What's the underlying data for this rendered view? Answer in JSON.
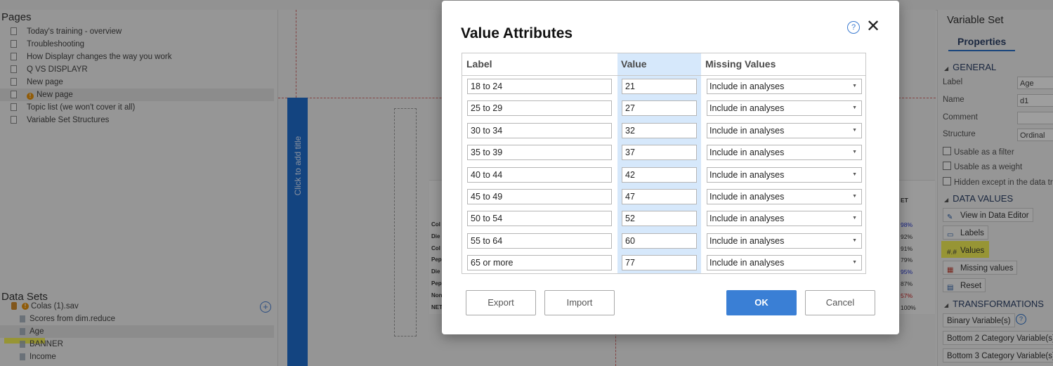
{
  "left_pane": {
    "pages_heading": "Pages",
    "pages": [
      {
        "label": "Today's training - overview",
        "warning": false,
        "selected": false
      },
      {
        "label": "Troubleshooting",
        "warning": false,
        "selected": false
      },
      {
        "label": "How Displayr changes the way you work",
        "warning": false,
        "selected": false
      },
      {
        "label": "Q VS DISPLAYR",
        "warning": false,
        "selected": false
      },
      {
        "label": "New page",
        "warning": false,
        "selected": false
      },
      {
        "label": "New page",
        "warning": true,
        "selected": true
      },
      {
        "label": "Topic list (we won't cover it all)",
        "warning": false,
        "selected": false
      },
      {
        "label": "Variable Set Structures",
        "warning": false,
        "selected": false
      }
    ],
    "datasets_heading": "Data Sets",
    "datasets": [
      {
        "label": "Colas (1).sav",
        "kind": "file"
      },
      {
        "label": "Scores from dim.reduce",
        "kind": "variable"
      },
      {
        "label": "Age",
        "kind": "variable",
        "selected": true
      },
      {
        "label": "BANNER",
        "kind": "variable"
      },
      {
        "label": "Income",
        "kind": "variable"
      }
    ]
  },
  "canvas": {
    "title_placeholder": "Click to add title",
    "background_rows": [
      "Col",
      "Die",
      "Col",
      "Pep",
      "Die",
      "Pep",
      "Non",
      "NET"
    ],
    "background_header": "ET",
    "background_pcts": [
      "98%",
      "92%",
      "91%",
      "79%",
      "95%",
      "87%",
      "57%",
      "100%"
    ]
  },
  "right_pane": {
    "title": "Variable Set",
    "tab": "Properties",
    "general_heading": "GENERAL",
    "fields": {
      "label": {
        "label": "Label",
        "value": "Age"
      },
      "name": {
        "label": "Name",
        "value": "d1"
      },
      "comment": {
        "label": "Comment",
        "value": ""
      },
      "structure": {
        "label": "Structure",
        "value": "Ordinal"
      }
    },
    "checkboxes": [
      "Usable as a filter",
      "Usable as a weight",
      "Hidden except in the data tr"
    ],
    "data_values_heading": "DATA VALUES",
    "data_values_buttons": {
      "view": "View in Data Editor",
      "labels": "Labels",
      "values": "Values",
      "missing": "Missing values",
      "reset": "Reset"
    },
    "transformations_heading": "TRANSFORMATIONS",
    "transformations_buttons": [
      "Binary Variable(s)",
      "Bottom 2 Category Variable(s)",
      "Bottom 3 Category Variable(s)"
    ]
  },
  "dialog": {
    "title": "Value Attributes",
    "help_glyph": "?",
    "close_glyph": "✕",
    "columns": {
      "label": "Label",
      "value": "Value",
      "missing": "Missing Values"
    },
    "rows": [
      {
        "label": "18 to 24",
        "value": "21",
        "missing": "Include in analyses"
      },
      {
        "label": "25 to 29",
        "value": "27",
        "missing": "Include in analyses"
      },
      {
        "label": "30 to 34",
        "value": "32",
        "missing": "Include in analyses"
      },
      {
        "label": "35 to 39",
        "value": "37",
        "missing": "Include in analyses"
      },
      {
        "label": "40 to 44",
        "value": "42",
        "missing": "Include in analyses"
      },
      {
        "label": "45 to 49",
        "value": "47",
        "missing": "Include in analyses"
      },
      {
        "label": "50 to 54",
        "value": "52",
        "missing": "Include in analyses"
      },
      {
        "label": "55 to 64",
        "value": "60",
        "missing": "Include in analyses"
      },
      {
        "label": "65 or more",
        "value": "77",
        "missing": "Include in analyses"
      }
    ],
    "buttons": {
      "export": "Export",
      "import": "Import",
      "ok": "OK",
      "cancel": "Cancel"
    },
    "accent_color": "#3a7fd5",
    "value_column_color": "#d6e8fb"
  }
}
